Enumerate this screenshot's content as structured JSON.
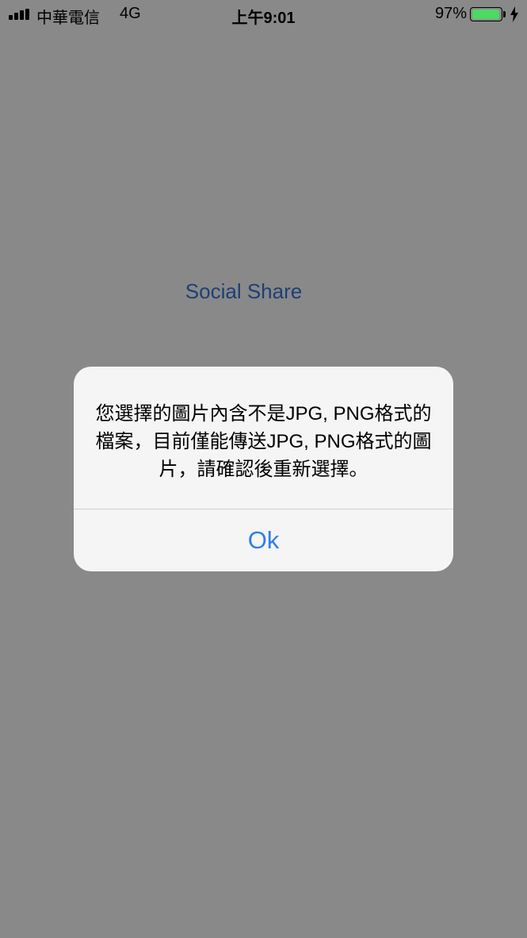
{
  "status_bar": {
    "carrier": "中華電信",
    "network": "4G",
    "time": "上午9:01",
    "battery_percent": "97%",
    "battery_level": 0.97,
    "signal_bars": 4
  },
  "main": {
    "social_share_label": "Social Share"
  },
  "alert": {
    "message": "您選擇的圖片內含不是JPG, PNG格式的檔案，目前僅能傳送JPG, PNG格式的圖片，請確認後重新選擇。",
    "ok_label": "Ok"
  },
  "colors": {
    "background": "#898989",
    "link": "#1e3f75",
    "alert_button": "#2f7fe4",
    "battery": "#4cd964"
  }
}
